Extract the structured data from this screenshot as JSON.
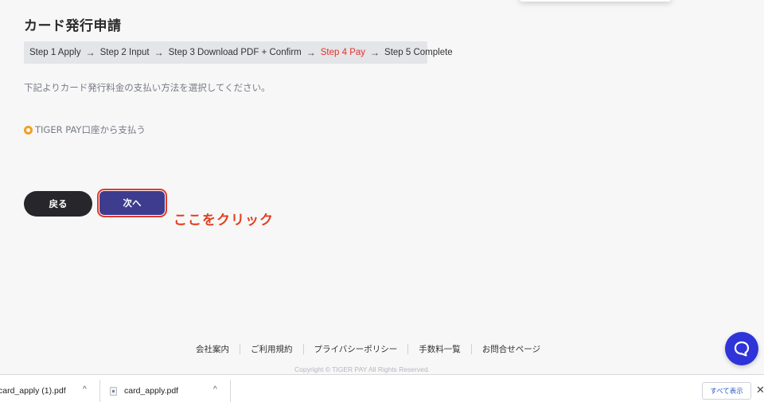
{
  "page": {
    "title": "カード発行申請",
    "instruction": "下記よりカード発行料金の支払い方法を選択してください。"
  },
  "steps": [
    {
      "label": "Step 1 Apply",
      "active": false
    },
    {
      "label": "Step 2 Input",
      "active": false
    },
    {
      "label": "Step 3 Download PDF + Confirm",
      "active": false
    },
    {
      "label": "Step 4 Pay",
      "active": true
    },
    {
      "label": "Step 5 Complete",
      "active": false
    }
  ],
  "step_arrow": "→",
  "payment_option": {
    "label": "TIGER PAY口座から支払う",
    "selected": true
  },
  "buttons": {
    "back_label": "戻る",
    "next_label": "次へ"
  },
  "annotation": "ここをクリック",
  "footer": {
    "links": [
      "会社案内",
      "ご利用規約",
      "プライバシーポリシー",
      "手数料一覧",
      "お問合せページ"
    ],
    "copyright": "Copyright © TIGER PAY All Rights Reserved."
  },
  "downloads": {
    "items": [
      {
        "name": "card_apply (1).pdf"
      },
      {
        "name": "card_apply.pdf"
      }
    ],
    "show_all_label": "すべて表示",
    "close_glyph": "✕",
    "chevron_glyph": "^"
  },
  "colors": {
    "active_step": "#e0322b",
    "primary_button": "#3e3c8f",
    "highlight": "#e03a2a",
    "radio": "#f0a020",
    "chat": "#2e34d8"
  }
}
